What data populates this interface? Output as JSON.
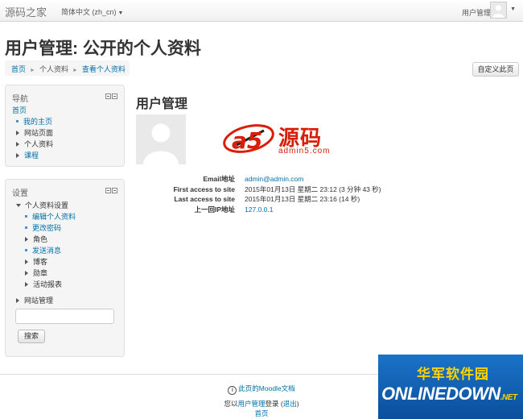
{
  "navbar": {
    "brand": "源码之家",
    "language": "简体中文 (zh_cn)",
    "user": "用户管理"
  },
  "page": {
    "title": "用户管理: 公开的个人资料"
  },
  "breadcrumb": [
    "首页",
    "个人资料",
    "查看个人资料"
  ],
  "customize_button": "自定义此页",
  "nav_block": {
    "title": "导航",
    "items": [
      "首页",
      "我的主页",
      "网站页面",
      "个人资料",
      "课程"
    ]
  },
  "settings_block": {
    "title": "设置",
    "profile_settings": "个人资料设置",
    "sub_items": [
      "编辑个人资料",
      "更改密码",
      "角色",
      "发送消息",
      "博客",
      "勋章",
      "活动报表"
    ],
    "site_admin": "网站管理",
    "search_button": "搜索"
  },
  "main": {
    "heading": "用户管理",
    "logo": {
      "brand_letters": "a5",
      "brand_text": "源码",
      "site": "admin5.com"
    },
    "details": [
      {
        "label": "Email地址",
        "value": "admin@admin.com"
      },
      {
        "label": "First access to site",
        "value": "2015年01月13日 星期二 23:12 (3 分钟 43 秒)"
      },
      {
        "label": "Last access to site",
        "value": "2015年01月13日 星期二 23:16 (14 秒)"
      },
      {
        "label": "上一回IP地址",
        "value": "127.0.0.1"
      }
    ]
  },
  "footer": {
    "docs_link": "此页的Moodle文档",
    "login_prefix": "您以",
    "login_user": "用户管理",
    "login_mid": "登录 (",
    "logout": "退出",
    "login_suffix": ")",
    "home": "首页"
  },
  "watermark": {
    "cn": "华军软件园",
    "en": "ONLINEDOWN",
    "net": ".NET"
  },
  "colors": {
    "link": "#0070a8",
    "logo_red": "#d81e06",
    "watermark_blue": "#1a73c8",
    "watermark_yellow": "#ffd200"
  }
}
